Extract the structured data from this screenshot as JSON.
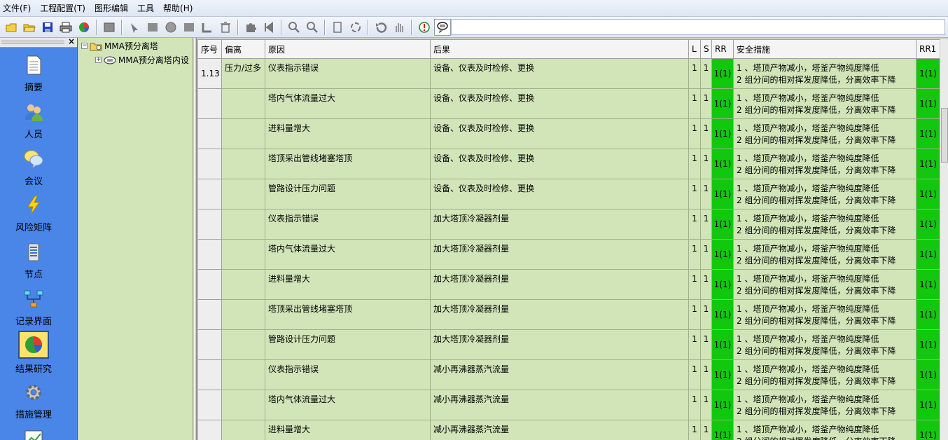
{
  "menu": [
    "文件(F)",
    "工程配置(T)",
    "图形编辑",
    "工具",
    "帮助(H)"
  ],
  "toolbar": {
    "icons": [
      "new-file-icon",
      "open-folder-icon",
      "save-icon",
      "print-icon",
      "pie-chart-icon",
      "grid-icon",
      "pointer-icon",
      "rectangle-icon",
      "circle-icon",
      "square-icon",
      "connect-icon",
      "delete-icon",
      "puzzle-icon",
      "first-icon",
      "zoom-in-icon",
      "zoom-out-icon",
      "fit-page-icon",
      "refresh-icon",
      "undo-icon",
      "hand-icon",
      "warning-icon",
      "comment-icon",
      "list-icon"
    ]
  },
  "nav": {
    "items": [
      {
        "label": "摘要",
        "icon": "document-icon"
      },
      {
        "label": "人员",
        "icon": "people-icon"
      },
      {
        "label": "会议",
        "icon": "speech-bubbles-icon"
      },
      {
        "label": "风险矩阵",
        "icon": "lightning-icon"
      },
      {
        "label": "节点",
        "icon": "server-icon"
      },
      {
        "label": "记录界面",
        "icon": "flowchart-icon"
      },
      {
        "label": "结果研究",
        "icon": "pie-chart-icon",
        "selected": true
      },
      {
        "label": "措施管理",
        "icon": "gear-icon"
      }
    ]
  },
  "tree": {
    "root": "MMA预分离塔",
    "child": "MMA预分离塔内设"
  },
  "grid": {
    "headers": [
      "序号",
      "偏离",
      "原因",
      "后果",
      "L",
      "S",
      "RR",
      "安全措施",
      "RR1"
    ],
    "measure_line1": "1 、塔顶产物减小，塔釜产物纯度降低",
    "measure_line2": "2 组分间的相对挥发度降低，分离效率下降",
    "rows": [
      {
        "seq": "1.13",
        "dev": "压力/过多",
        "cause": "仪表指示错误",
        "consequence": "设备、仪表及时检修、更换",
        "l": "1",
        "s": "1",
        "rr": "1(1)",
        "rr1": "1(1)"
      },
      {
        "seq": "",
        "dev": "",
        "cause": "塔内气体流量过大",
        "consequence": "设备、仪表及时检修、更换",
        "l": "1",
        "s": "1",
        "rr": "1(1)",
        "rr1": "1(1)"
      },
      {
        "seq": "",
        "dev": "",
        "cause": "进料量增大",
        "consequence": "设备、仪表及时检修、更换",
        "l": "1",
        "s": "1",
        "rr": "1(1)",
        "rr1": "1(1)"
      },
      {
        "seq": "",
        "dev": "",
        "cause": "塔顶采出管线堵塞塔顶",
        "consequence": "设备、仪表及时检修、更换",
        "l": "1",
        "s": "1",
        "rr": "1(1)",
        "rr1": "1(1)"
      },
      {
        "seq": "",
        "dev": "",
        "cause": "管路设计压力问题",
        "consequence": "设备、仪表及时检修、更换",
        "l": "1",
        "s": "1",
        "rr": "1(1)",
        "rr1": "1(1)"
      },
      {
        "seq": "",
        "dev": "",
        "cause": "仪表指示错误",
        "consequence": "加大塔顶冷凝器剂量",
        "l": "1",
        "s": "1",
        "rr": "1(1)",
        "rr1": "1(1)"
      },
      {
        "seq": "",
        "dev": "",
        "cause": "塔内气体流量过大",
        "consequence": "加大塔顶冷凝器剂量",
        "l": "1",
        "s": "1",
        "rr": "1(1)",
        "rr1": "1(1)"
      },
      {
        "seq": "",
        "dev": "",
        "cause": "进料量增大",
        "consequence": "加大塔顶冷凝器剂量",
        "l": "1",
        "s": "1",
        "rr": "1(1)",
        "rr1": "1(1)"
      },
      {
        "seq": "",
        "dev": "",
        "cause": "塔顶采出管线堵塞塔顶",
        "consequence": "加大塔顶冷凝器剂量",
        "l": "1",
        "s": "1",
        "rr": "1(1)",
        "rr1": "1(1)"
      },
      {
        "seq": "",
        "dev": "",
        "cause": "管路设计压力问题",
        "consequence": "加大塔顶冷凝器剂量",
        "l": "1",
        "s": "1",
        "rr": "1(1)",
        "rr1": "1(1)"
      },
      {
        "seq": "",
        "dev": "",
        "cause": "仪表指示错误",
        "consequence": "减小再沸器蒸汽流量",
        "l": "1",
        "s": "1",
        "rr": "1(1)",
        "rr1": "1(1)"
      },
      {
        "seq": "",
        "dev": "",
        "cause": "塔内气体流量过大",
        "consequence": "减小再沸器蒸汽流量",
        "l": "1",
        "s": "1",
        "rr": "1(1)",
        "rr1": "1(1)"
      },
      {
        "seq": "",
        "dev": "",
        "cause": "进料量增大",
        "consequence": "减小再沸器蒸汽流量",
        "l": "1",
        "s": "1",
        "rr": "1(1)",
        "rr1": "1(1)"
      }
    ]
  },
  "colors": {
    "risk_green": "#12c80e",
    "grid_bg": "#d1e5b8",
    "nav_blue": "#4a86e8"
  }
}
